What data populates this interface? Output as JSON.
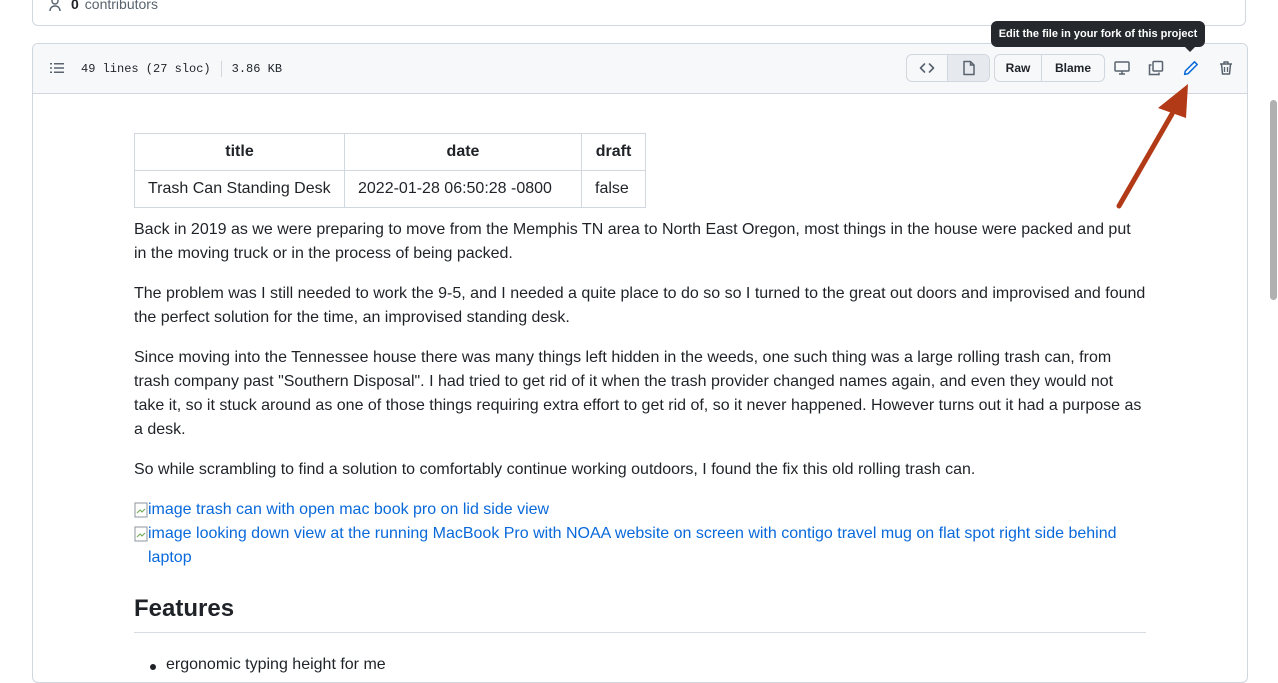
{
  "contributors": {
    "count": "0",
    "label": "contributors"
  },
  "file_header": {
    "lines": "49 lines (27 sloc)",
    "size": "3.86 KB",
    "raw_label": "Raw",
    "blame_label": "Blame",
    "tooltip": "Edit the file in your fork of this project"
  },
  "frontmatter": {
    "headers": [
      "title",
      "date",
      "draft"
    ],
    "row": [
      "Trash Can Standing Desk",
      "2022-01-28 06:50:28 -0800",
      "false"
    ]
  },
  "paragraphs": [
    "Back in 2019 as we were preparing to move from the Memphis TN area to North East Oregon, most things in the house were packed and put in the moving truck or in the process of being packed.",
    "The problem was I still needed to work the 9-5, and I needed a quite place to do so so I turned to the great out doors and improvised and found the perfect solution for the time, an improvised standing desk.",
    "Since moving into the Tennessee house there was many things left hidden in the weeds, one such thing was a large rolling trash can, from trash company past \"Southern Disposal\". I had tried to get rid of it when the trash provider changed names again, and even they would not take it, so it stuck around as one of those things requiring extra effort to get rid of, so it never happened. However turns out it had a purpose as a desk.",
    "So while scrambling to find a solution to comfortably continue working outdoors, I found the fix this old rolling trash can."
  ],
  "images": [
    "image trash can with open mac book pro on lid side view",
    "image looking down view at the running MacBook Pro with NOAA website on screen with contigo travel mug on flat spot right side behind laptop"
  ],
  "features_heading": "Features",
  "features_first_item": "ergonomic typing height for me",
  "colors": {
    "accent": "#0969da",
    "annotation_arrow": "#b33a16",
    "tooltip_bg": "#25292e"
  }
}
